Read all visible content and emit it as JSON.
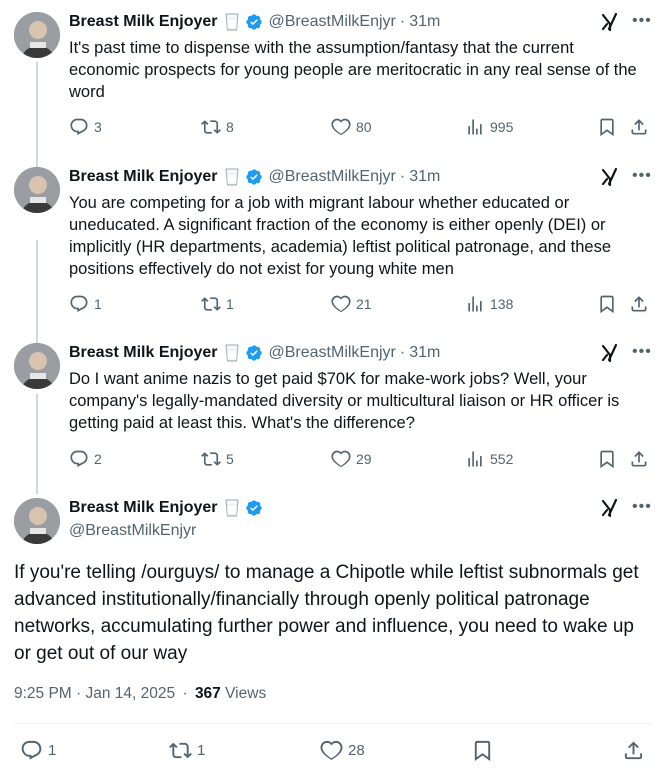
{
  "author": {
    "name": "Breast Milk Enjoyer",
    "handle": "@BreastMilkEnjyr",
    "emoji": "milk-glass-emoji",
    "verified": true
  },
  "separator": "·",
  "replies": [
    {
      "time": "31m",
      "text": "It's past time to dispense with the assumption/fantasy that the current economic prospects for young people are meritocratic in any real sense of the word",
      "stats": {
        "replies": "3",
        "reposts": "8",
        "likes": "80",
        "views": "995"
      }
    },
    {
      "time": "31m",
      "text": "You are competing for a job with migrant labour whether educated or uneducated. A significant fraction of the economy is either openly (DEI) or implicitly (HR departments, academia) leftist political patronage, and these positions effectively do not exist for young white men",
      "stats": {
        "replies": "1",
        "reposts": "1",
        "likes": "21",
        "views": "138"
      }
    },
    {
      "time": "31m",
      "text": "Do I want anime nazis to get paid $70K for make-work jobs? Well, your company's legally-mandated diversity or multicultural liaison or HR officer is getting paid at least this. What's the difference?",
      "stats": {
        "replies": "2",
        "reposts": "5",
        "likes": "29",
        "views": "552"
      }
    }
  ],
  "main": {
    "text": "If you're telling /ourguys/ to manage a Chipotle while leftist subnormals get advanced institutionally/financially through openly political patronage networks, accumulating further power and influence, you need to wake up or get out of our way",
    "time": "9:25 PM · Jan 14, 2025",
    "views_count": "367",
    "views_label": "Views",
    "stats": {
      "replies": "1",
      "reposts": "1",
      "likes": "28"
    }
  },
  "colors": {
    "verified": "#1d9bf0",
    "muted": "#536471",
    "text": "#0f1419",
    "thread": "#cfd9de"
  },
  "icons": [
    "reply-icon",
    "repost-icon",
    "like-icon",
    "views-icon",
    "bookmark-icon",
    "share-icon",
    "grok-icon",
    "more-icon",
    "verified-badge-icon"
  ]
}
